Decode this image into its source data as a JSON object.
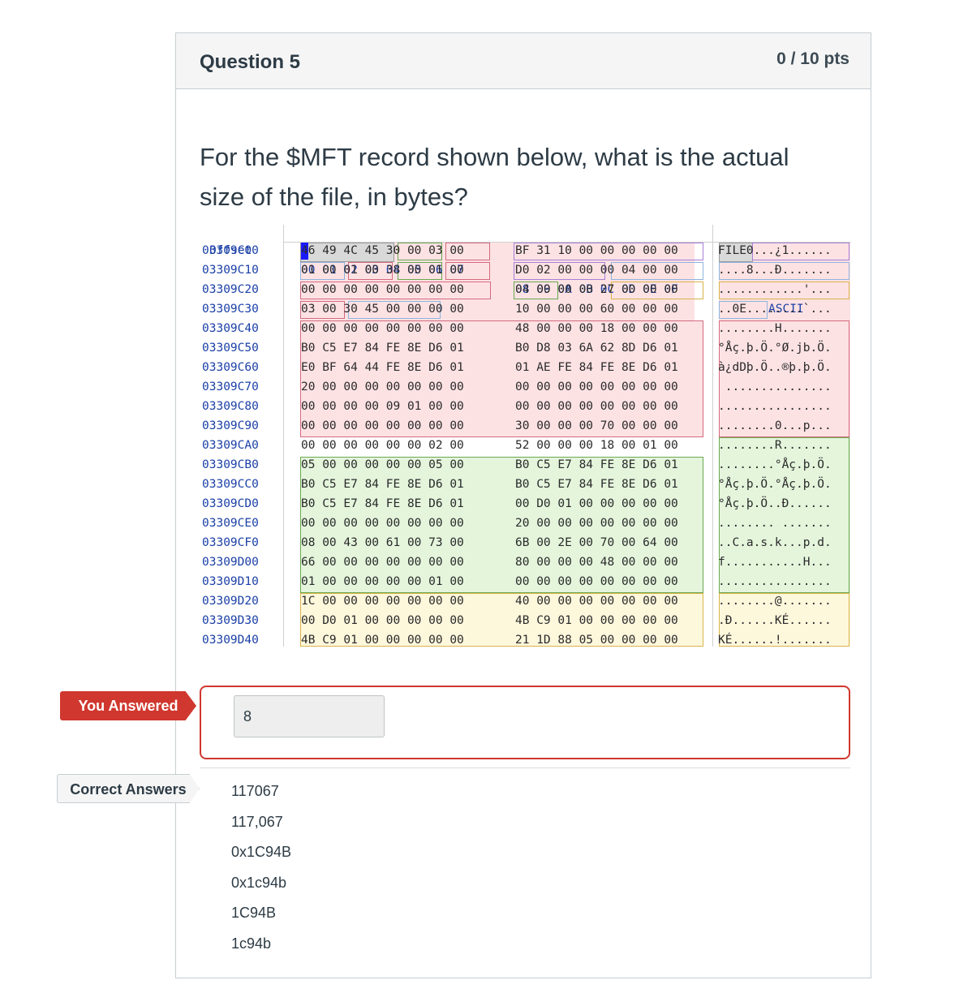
{
  "question": {
    "title": "Question 5",
    "points": "0 / 10 pts",
    "text": "For the $MFT record shown below, what is the actual size of the file, in bytes?"
  },
  "hexdump": {
    "header": {
      "offset": "Offset",
      "cols1": "00 01 02 03 04 05 06 07",
      "cols2": "08 09 0A 0B 0C 0D 0E 0F",
      "ascii": "ASCII"
    },
    "rows": [
      {
        "off": "03309C00",
        "h1": "46 49 4C 45 30 00 03 00",
        "h2": "BF 31 10 00 00 00 00 00",
        "a": "FILE0...¿1......"
      },
      {
        "off": "03309C10",
        "h1": "01 00 01 00 38 00 01 00",
        "h2": "D0 02 00 00 00 04 00 00",
        "a": "....8...Ð......."
      },
      {
        "off": "03309C20",
        "h1": "00 00 00 00 00 00 00 00",
        "h2": "04 00 00 00 27 00 00 00",
        "a": "............'..."
      },
      {
        "off": "03309C30",
        "h1": "03 00 30 45 00 00 00 00",
        "h2": "10 00 00 00 60 00 00 00",
        "a": "..0E........`..."
      },
      {
        "off": "03309C40",
        "h1": "00 00 00 00 00 00 00 00",
        "h2": "48 00 00 00 18 00 00 00",
        "a": "........H......."
      },
      {
        "off": "03309C50",
        "h1": "B0 C5 E7 84 FE 8E D6 01",
        "h2": "B0 D8 03 6A 62 8D D6 01",
        "a": "°Åç.þ.Ö.°Ø.jb.Ö."
      },
      {
        "off": "03309C60",
        "h1": "E0 BF 64 44 FE 8E D6 01",
        "h2": "01 AE FE 84 FE 8E D6 01",
        "a": "à¿dDþ.Ö..®þ.þ.Ö."
      },
      {
        "off": "03309C70",
        "h1": "20 00 00 00 00 00 00 00",
        "h2": "00 00 00 00 00 00 00 00",
        "a": " ..............."
      },
      {
        "off": "03309C80",
        "h1": "00 00 00 00 09 01 00 00",
        "h2": "00 00 00 00 00 00 00 00",
        "a": "................"
      },
      {
        "off": "03309C90",
        "h1": "00 00 00 00 00 00 00 00",
        "h2": "30 00 00 00 70 00 00 00",
        "a": "........0...p..."
      },
      {
        "off": "03309CA0",
        "h1": "00 00 00 00 00 00 02 00",
        "h2": "52 00 00 00 18 00 01 00",
        "a": "........R......."
      },
      {
        "off": "03309CB0",
        "h1": "05 00 00 00 00 00 05 00",
        "h2": "B0 C5 E7 84 FE 8E D6 01",
        "a": "........°Åç.þ.Ö."
      },
      {
        "off": "03309CC0",
        "h1": "B0 C5 E7 84 FE 8E D6 01",
        "h2": "B0 C5 E7 84 FE 8E D6 01",
        "a": "°Åç.þ.Ö.°Åç.þ.Ö."
      },
      {
        "off": "03309CD0",
        "h1": "B0 C5 E7 84 FE 8E D6 01",
        "h2": "00 D0 01 00 00 00 00 00",
        "a": "°Åç.þ.Ö..Ð......"
      },
      {
        "off": "03309CE0",
        "h1": "00 00 00 00 00 00 00 00",
        "h2": "20 00 00 00 00 00 00 00",
        "a": "........ ......."
      },
      {
        "off": "03309CF0",
        "h1": "08 00 43 00 61 00 73 00",
        "h2": "6B 00 2E 00 70 00 64 00",
        "a": "..C.a.s.k...p.d."
      },
      {
        "off": "03309D00",
        "h1": "66 00 00 00 00 00 00 00",
        "h2": "80 00 00 00 48 00 00 00",
        "a": "f...........H..."
      },
      {
        "off": "03309D10",
        "h1": "01 00 00 00 00 00 01 00",
        "h2": "00 00 00 00 00 00 00 00",
        "a": "................"
      },
      {
        "off": "03309D20",
        "h1": "1C 00 00 00 00 00 00 00",
        "h2": "40 00 00 00 00 00 00 00",
        "a": "........@......."
      },
      {
        "off": "03309D30",
        "h1": "00 D0 01 00 00 00 00 00",
        "h2": "4B C9 01 00 00 00 00 00",
        "a": ".Ð......KÉ......"
      },
      {
        "off": "03309D40",
        "h1": "4B C9 01 00 00 00 00 00",
        "h2": "21 1D 88 05 00 00 00 00",
        "a": "KÉ......!......."
      }
    ]
  },
  "answer": {
    "you_answered_label": "You Answered",
    "value": "8",
    "correct_label": "Correct Answers",
    "correct": [
      "117067",
      "117,067",
      "0x1C94B",
      "0x1c94b",
      "1C94B",
      "1c94b"
    ]
  },
  "colors": {
    "wrong": "#d0372e",
    "pink": "#fde2e4",
    "green": "#e4f5dc",
    "yellow": "#fdf7dc",
    "blue": "#e3edf8",
    "hex_header": "#1a3fa6"
  }
}
